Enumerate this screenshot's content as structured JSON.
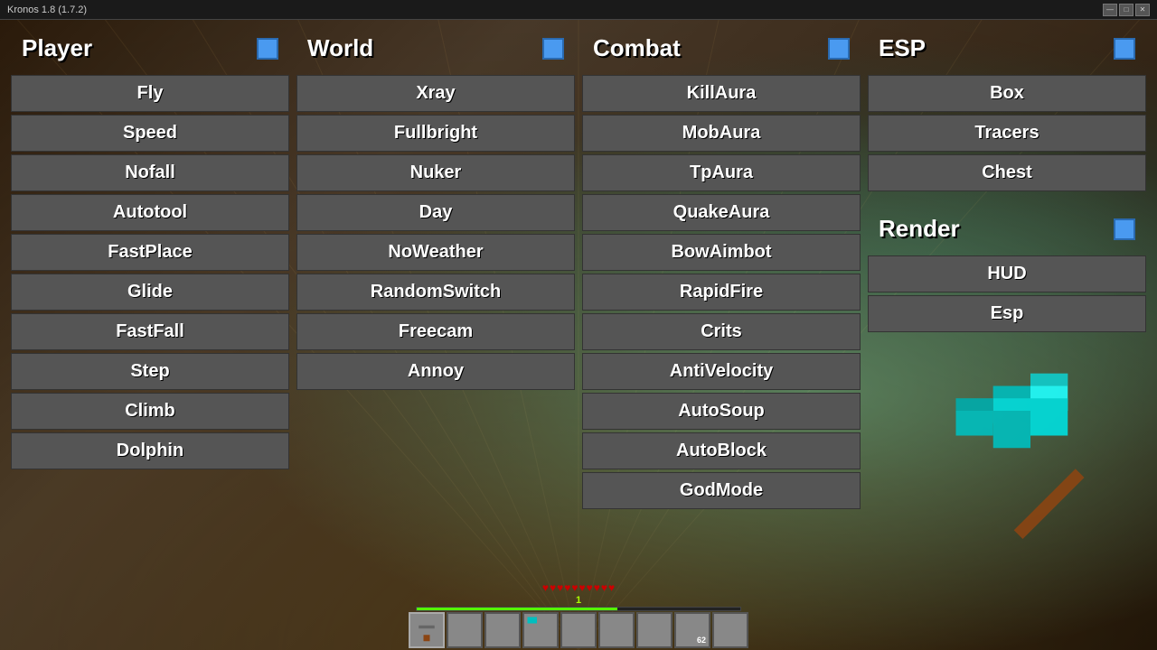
{
  "titlebar": {
    "title": "Kronos 1.8 (1.7.2)",
    "minimize": "—",
    "maximize": "□",
    "close": "✕"
  },
  "panels": {
    "player": {
      "title": "Player",
      "toggle_color": "#4a9af0",
      "items": [
        "Fly",
        "Speed",
        "Nofall",
        "Autotool",
        "FastPlace",
        "Glide",
        "FastFall",
        "Step",
        "Climb",
        "Dolphin"
      ]
    },
    "world": {
      "title": "World",
      "toggle_color": "#4a9af0",
      "items": [
        "Xray",
        "Fullbright",
        "Nuker",
        "Day",
        "NoWeather",
        "RandomSwitch",
        "Freecam",
        "Annoy"
      ]
    },
    "combat": {
      "title": "Combat",
      "toggle_color": "#4a9af0",
      "items": [
        "KillAura",
        "MobAura",
        "TpAura",
        "QuakeAura",
        "BowAimbot",
        "RapidFire",
        "Crits",
        "AntiVelocity",
        "AutoSoup",
        "AutoBlock",
        "GodMode"
      ]
    },
    "esp": {
      "title": "ESP",
      "toggle_color": "#4a9af0",
      "items": [
        "Box",
        "Tracers",
        "Chest"
      ]
    },
    "render": {
      "title": "Render",
      "toggle_color": "#4a9af0",
      "items": [
        "HUD",
        "Esp"
      ]
    }
  },
  "hud": {
    "level": "1",
    "exp_bar": "62",
    "hearts": 10,
    "slots": 9
  }
}
